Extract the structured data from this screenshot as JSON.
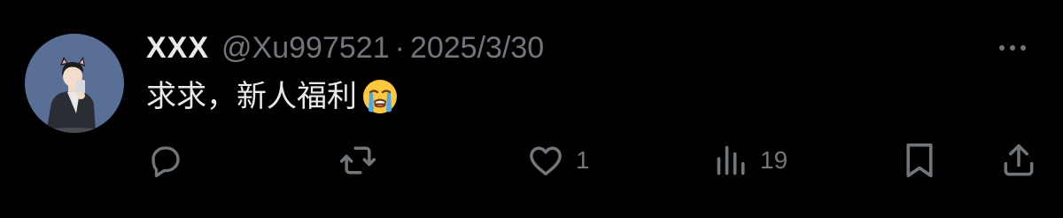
{
  "tweet": {
    "display_name": "XXX",
    "handle": "@Xu997521",
    "separator": "·",
    "date": "2025/3/30",
    "text": "求求，新人福利",
    "emoji": "loudly-crying-face"
  },
  "actions": {
    "reply": {
      "icon": "reply-icon",
      "count": ""
    },
    "retweet": {
      "icon": "retweet-icon",
      "count": ""
    },
    "like": {
      "icon": "heart-icon",
      "count": "1"
    },
    "views": {
      "icon": "views-icon",
      "count": "19"
    },
    "bookmark": {
      "icon": "bookmark-icon",
      "count": ""
    },
    "share": {
      "icon": "share-icon",
      "count": ""
    }
  },
  "colors": {
    "background": "#000000",
    "primary_text": "#e7e9ea",
    "secondary_text": "#71767b",
    "avatar_bg": "#5a6f96"
  }
}
